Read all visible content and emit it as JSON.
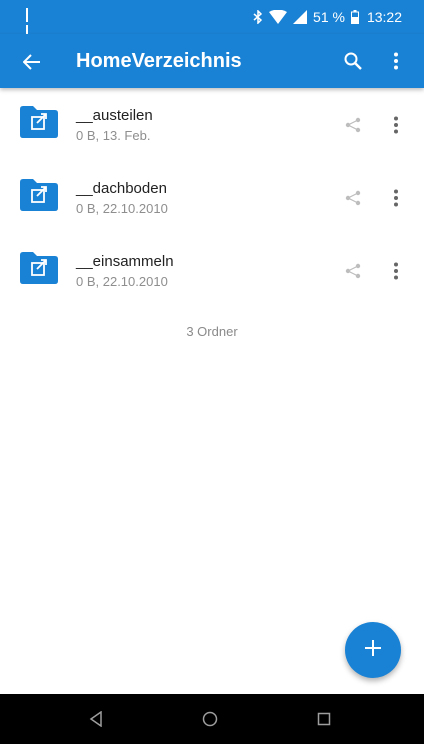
{
  "status_bar": {
    "battery_percent": "51 %",
    "time": "13:22",
    "icons": [
      "notification-icon",
      "bluetooth-icon",
      "wifi-icon",
      "signal-icon",
      "battery-icon"
    ]
  },
  "app_bar": {
    "title": "HomeVerzeichnis",
    "icons": [
      "back-arrow-icon",
      "search-icon",
      "more-vert-icon"
    ]
  },
  "folders": [
    {
      "name": "__austeilen",
      "meta": "0 B, 13. Feb."
    },
    {
      "name": "__dachboden",
      "meta": "0 B, 22.10.2010"
    },
    {
      "name": "__einsammeln",
      "meta": "0 B, 22.10.2010"
    }
  ],
  "folder_count": "3 Ordner",
  "fab": {
    "icon": "plus-icon"
  },
  "nav_bar": {
    "icons": [
      "back-triangle-icon",
      "home-circle-icon",
      "recents-square-icon"
    ]
  },
  "colors": {
    "primary": "#1a82d4",
    "text": "#222222",
    "secondary_text": "#8e8e8e"
  }
}
